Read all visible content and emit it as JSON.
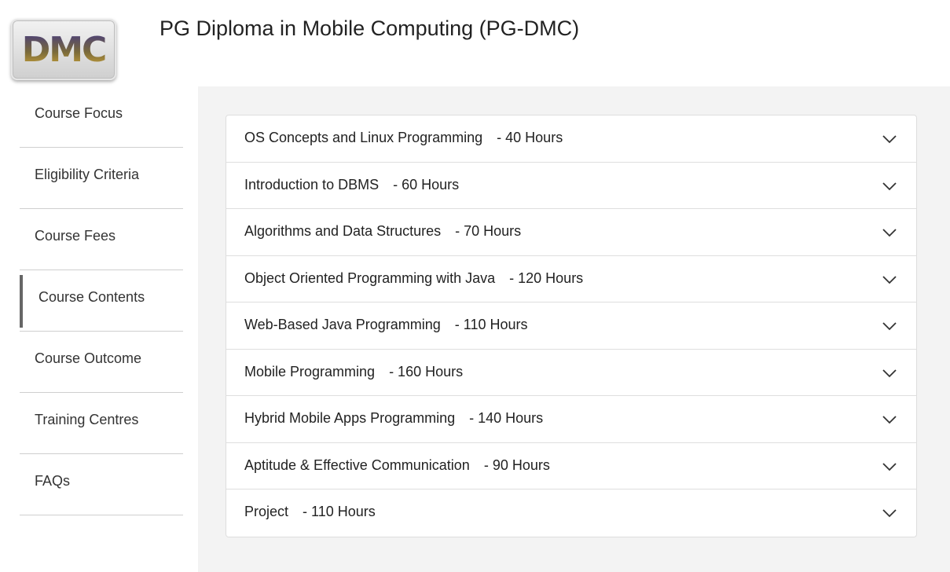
{
  "logo": {
    "text": "DMC"
  },
  "page": {
    "title": "PG Diploma in Mobile Computing (PG-DMC)"
  },
  "sidebar": {
    "items": [
      {
        "label": "Course Focus",
        "active": false
      },
      {
        "label": "Eligibility Criteria",
        "active": false
      },
      {
        "label": "Course Fees",
        "active": false
      },
      {
        "label": "Course Contents",
        "active": true
      },
      {
        "label": "Course Outcome",
        "active": false
      },
      {
        "label": "Training Centres",
        "active": false
      },
      {
        "label": "FAQs",
        "active": false
      }
    ]
  },
  "modules": [
    {
      "name": "OS Concepts and Linux Programming",
      "hours": "- 40 Hours"
    },
    {
      "name": "Introduction to DBMS",
      "hours": "- 60 Hours"
    },
    {
      "name": "Algorithms and Data Structures",
      "hours": "- 70 Hours"
    },
    {
      "name": "Object Oriented Programming with Java",
      "hours": "- 120 Hours"
    },
    {
      "name": "Web-Based Java Programming",
      "hours": "- 110 Hours"
    },
    {
      "name": "Mobile Programming",
      "hours": "- 160 Hours"
    },
    {
      "name": "Hybrid Mobile Apps Programming",
      "hours": "- 140 Hours"
    },
    {
      "name": "Aptitude & Effective Communication",
      "hours": "- 90 Hours"
    },
    {
      "name": "Project",
      "hours": "- 110 Hours"
    }
  ],
  "icons": {
    "expand": "chevron-down-icon"
  },
  "colors": {
    "content_bg": "#f3f3f3",
    "active_marker": "#666666"
  }
}
